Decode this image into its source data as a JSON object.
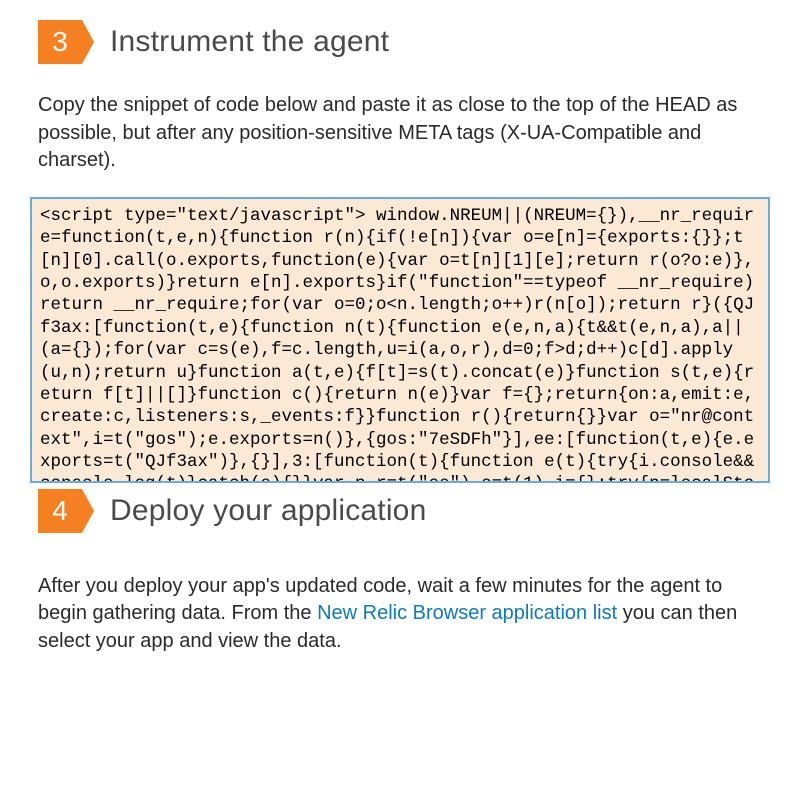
{
  "step3": {
    "number": "3",
    "title": "Instrument the agent",
    "body": "Copy the snippet of code below and paste it as close to the top of the HEAD as possible, but after any position-sensitive META tags (X-UA-Compatible and charset).",
    "code": "<script type=\"text/javascript\">\nwindow.NREUM||(NREUM={}),__nr_require=function(t,e,n){function r(n){if(!e[n]){var o=e[n]={exports:{}};t[n][0].call(o.exports,function(e){var o=t[n][1][e];return r(o?o:e)},o,o.exports)}return e[n].exports}if(\"function\"==typeof __nr_require)return __nr_require;for(var o=0;o<n.length;o++)r(n[o]);return r}({QJf3ax:[function(t,e){function n(t){function e(e,n,a){t&&t(e,n,a),a||(a={});for(var c=s(e),f=c.length,u=i(a,o,r),d=0;f>d;d++)c[d].apply(u,n);return u}function a(t,e){f[t]=s(t).concat(e)}function s(t,e){return f[t]||[]}function c(){return n(e)}var f={};return{on:a,emit:e,create:c,listeners:s,_events:f}}function r(){return{}}var o=\"nr@context\",i=t(\"gos\");e.exports=n()},{gos:\"7eSDFh\"}],ee:[function(t,e){e.exports=t(\"QJf3ax\")},{}],3:[function(t){function e(t){try{i.console&&console.log(t)}catch(e){}}var n,r=t(\"ee\"),o=t(1),i={};try{n=localStorage.getItem(\"__nr_flags\").split(\",\"),console&&\"function\"==typeof console.log&&(i.console=!0,-1!==n.indexOf(\"dev\")&&"
  },
  "step4": {
    "number": "4",
    "title": "Deploy your application",
    "body_before_link": "After you deploy your app's updated code, wait a few minutes for the agent to begin gathering data. From the ",
    "link_text": "New Relic Browser application list",
    "body_after_link": " you can then select your app and view the data."
  }
}
